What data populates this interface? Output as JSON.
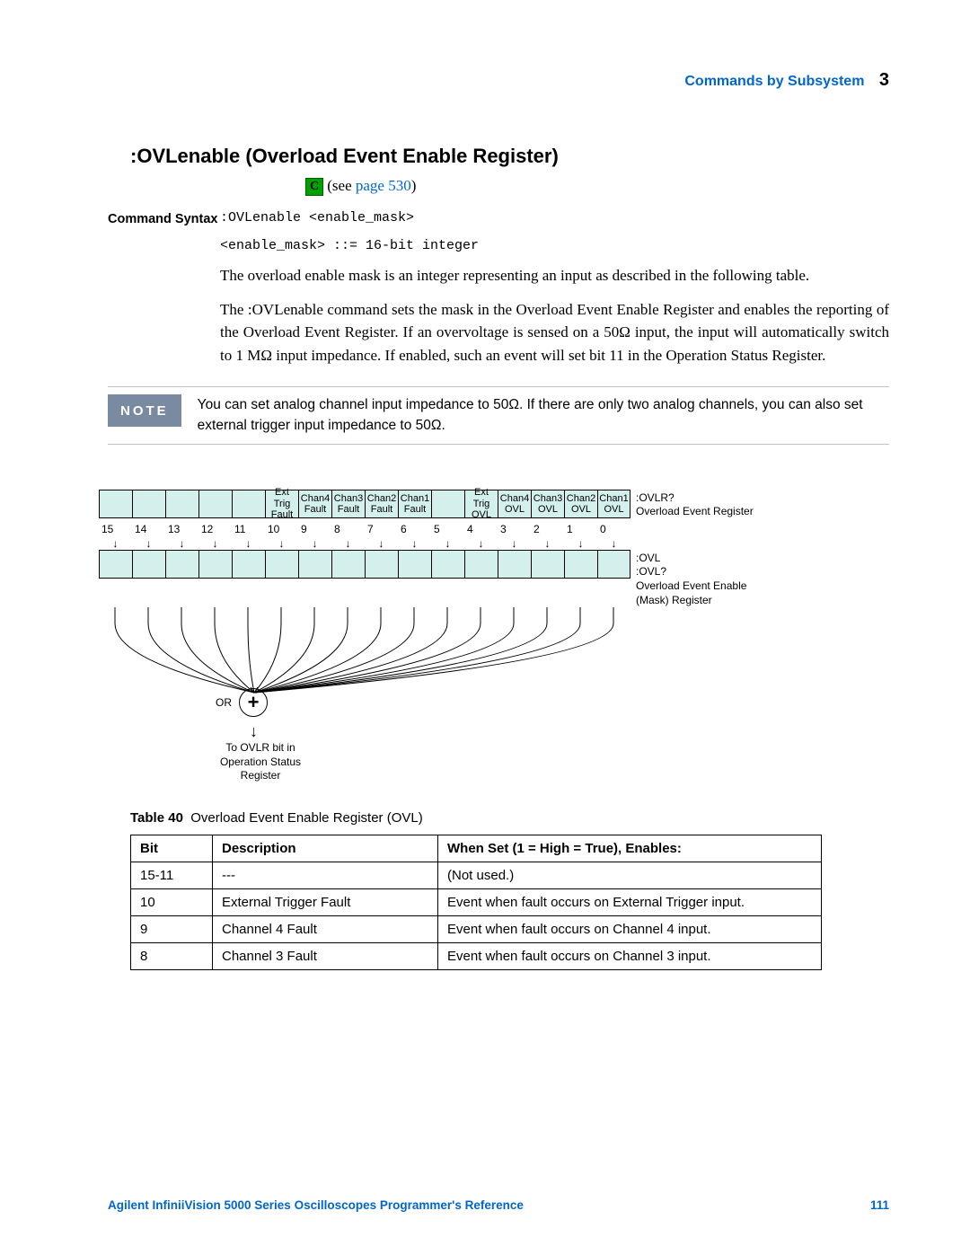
{
  "header": {
    "section": "Commands by Subsystem",
    "chapter": "3"
  },
  "title": ":OVLenable (Overload Event Enable Register)",
  "see_prefix": "(see ",
  "see_link": "page 530",
  "see_suffix": ")",
  "cmd_syntax_label": "Command Syntax",
  "cmd_syntax_line1": ":OVLenable <enable_mask>",
  "cmd_syntax_line2": "<enable_mask> ::= 16-bit integer",
  "para1": "The overload enable mask is an integer representing an input as described in the following table.",
  "para2": "The :OVLenable command sets the mask in the Overload Event Enable Register and enables the reporting of the Overload Event Register. If an overvoltage is sensed on a 50Ω input, the input will automatically switch to 1 MΩ input impedance. If enabled, such an event will set bit 11 in the Operation Status Register.",
  "note_label": "NOTE",
  "note_text": "You can set analog channel input impedance to 50Ω. If there are only two analog channels, you can also set external trigger input impedance to 50Ω.",
  "diagram": {
    "top_cells": [
      "",
      "",
      "",
      "",
      "",
      "Ext Trig\nFault",
      "Chan4\nFault",
      "Chan3\nFault",
      "Chan2\nFault",
      "Chan1\nFault",
      "",
      "Ext Trig\nOVL",
      "Chan4\nOVL",
      "Chan3\nOVL",
      "Chan2\nOVL",
      "Chan1\nOVL"
    ],
    "top_right_label": ":OVLR?\nOverload Event Register",
    "bits": [
      "15",
      "14",
      "13",
      "12",
      "11",
      "10",
      "9",
      "8",
      "7",
      "6",
      "5",
      "4",
      "3",
      "2",
      "1",
      "0"
    ],
    "bottom_right_label": ":OVL\n:OVL?\nOverload Event Enable\n(Mask) Register",
    "or_label": "OR",
    "or_symbol": "+",
    "output_label": "To OVLR bit in\nOperation Status\nRegister"
  },
  "table_caption_bold": "Table 40",
  "table_caption_rest": "Overload Event Enable Register (OVL)",
  "table": {
    "headers": [
      "Bit",
      "Description",
      "When Set (1 = High = True), Enables:"
    ],
    "rows": [
      [
        "15-11",
        "---",
        "(Not used.)"
      ],
      [
        "10",
        "External Trigger Fault",
        "Event when fault occurs on External Trigger input."
      ],
      [
        "9",
        "Channel 4 Fault",
        "Event when fault occurs on Channel 4 input."
      ],
      [
        "8",
        "Channel 3 Fault",
        "Event when fault occurs on Channel 3 input."
      ]
    ]
  },
  "footer": {
    "left": "Agilent InfiniiVision 5000 Series Oscilloscopes Programmer's Reference",
    "right": "111"
  }
}
